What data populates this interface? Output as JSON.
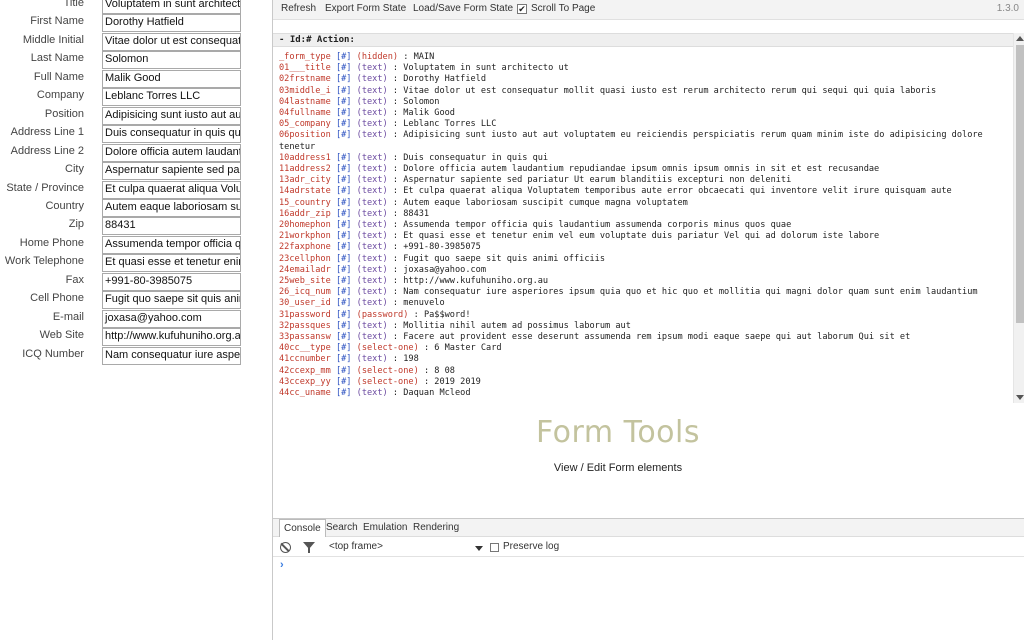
{
  "form": {
    "fields": [
      {
        "label": "Title",
        "value": "Voluptatem in sunt architecto ut"
      },
      {
        "label": "First Name",
        "value": "Dorothy Hatfield"
      },
      {
        "label": "Middle Initial",
        "value": "Vitae dolor ut est consequatur"
      },
      {
        "label": "Last Name",
        "value": "Solomon"
      },
      {
        "label": "Full Name",
        "value": "Malik Good"
      },
      {
        "label": "Company",
        "value": "Leblanc Torres LLC"
      },
      {
        "label": "Position",
        "value": "Adipisicing sunt iusto aut aut"
      },
      {
        "label": "Address Line 1",
        "value": "Duis consequatur in quis qui"
      },
      {
        "label": "Address Line 2",
        "value": "Dolore officia autem laudantium"
      },
      {
        "label": "City",
        "value": "Aspernatur sapiente sed pariatur"
      },
      {
        "label": "State / Province",
        "value": "Et culpa quaerat aliqua Voluptatem"
      },
      {
        "label": "Country",
        "value": "Autem eaque laboriosam suscipit"
      },
      {
        "label": "Zip",
        "value": "88431"
      },
      {
        "label": "Home Phone",
        "value": "Assumenda tempor officia quis"
      },
      {
        "label": "Work Telephone",
        "value": "Et quasi esse et tenetur enim"
      },
      {
        "label": "Fax",
        "value": "+991-80-3985075"
      },
      {
        "label": "Cell Phone",
        "value": "Fugit quo saepe sit quis animi"
      },
      {
        "label": "E-mail",
        "value": "joxasa@yahoo.com"
      },
      {
        "label": "Web Site",
        "value": "http://www.kufuhuniho.org.au"
      },
      {
        "label": "ICQ Number",
        "value": "Nam consequatur iure asperiores"
      }
    ]
  },
  "toolbar": {
    "refresh": "Refresh",
    "export": "Export Form State",
    "load_save": "Load/Save Form State",
    "scroll_to_page": "Scroll To Page",
    "scroll_checked": "✔",
    "version": "1.3.0"
  },
  "log": {
    "header": "-  Id:# Action:",
    "lines": [
      {
        "name": "_form_type",
        "hash": "[#]",
        "type": "(hidden)",
        "value": ": MAIN"
      },
      {
        "name": "01___title",
        "hash": "[#]",
        "type": "(text)",
        "value": ": Voluptatem in sunt architecto ut"
      },
      {
        "name": "02frstname",
        "hash": "[#]",
        "type": "(text)",
        "value": ": Dorothy Hatfield"
      },
      {
        "name": "03middle_i",
        "hash": "[#]",
        "type": "(text)",
        "value": ": Vitae dolor ut est consequatur mollit quasi iusto est rerum architecto rerum qui sequi qui quia laboris"
      },
      {
        "name": "04lastname",
        "hash": "[#]",
        "type": "(text)",
        "value": ": Solomon"
      },
      {
        "name": "04fullname",
        "hash": "[#]",
        "type": "(text)",
        "value": ": Malik Good"
      },
      {
        "name": "05_company",
        "hash": "[#]",
        "type": "(text)",
        "value": ": Leblanc Torres LLC"
      },
      {
        "name": "06position",
        "hash": "[#]",
        "type": "(text)",
        "value": ": Adipisicing sunt iusto aut aut voluptatem eu reiciendis perspiciatis rerum quam minim iste do adipisicing dolore tenetur"
      },
      {
        "name": "10address1",
        "hash": "[#]",
        "type": "(text)",
        "value": ": Duis consequatur in quis qui"
      },
      {
        "name": "11address2",
        "hash": "[#]",
        "type": "(text)",
        "value": ": Dolore officia autem laudantium repudiandae ipsum omnis ipsum omnis in sit et est recusandae"
      },
      {
        "name": "13adr_city",
        "hash": "[#]",
        "type": "(text)",
        "value": ": Aspernatur sapiente sed pariatur Ut earum blanditiis excepturi non deleniti"
      },
      {
        "name": "14adrstate",
        "hash": "[#]",
        "type": "(text)",
        "value": ": Et culpa quaerat aliqua Voluptatem temporibus aute error obcaecati qui inventore velit irure quisquam aute"
      },
      {
        "name": "15_country",
        "hash": "[#]",
        "type": "(text)",
        "value": ": Autem eaque laboriosam suscipit cumque magna voluptatem"
      },
      {
        "name": "16addr_zip",
        "hash": "[#]",
        "type": "(text)",
        "value": ": 88431"
      },
      {
        "name": "20homephon",
        "hash": "[#]",
        "type": "(text)",
        "value": ": Assumenda tempor officia quis laudantium assumenda corporis minus quos quae"
      },
      {
        "name": "21workphon",
        "hash": "[#]",
        "type": "(text)",
        "value": ": Et quasi esse et tenetur enim vel eum voluptate duis pariatur Vel qui ad dolorum iste labore"
      },
      {
        "name": "22faxphone",
        "hash": "[#]",
        "type": "(text)",
        "value": ": +991-80-3985075"
      },
      {
        "name": "23cellphon",
        "hash": "[#]",
        "type": "(text)",
        "value": ": Fugit quo saepe sit quis animi officiis"
      },
      {
        "name": "24emailadr",
        "hash": "[#]",
        "type": "(text)",
        "value": ": joxasa@yahoo.com"
      },
      {
        "name": "25web_site",
        "hash": "[#]",
        "type": "(text)",
        "value": ": http://www.kufuhuniho.org.au"
      },
      {
        "name": "26_icq_num",
        "hash": "[#]",
        "type": "(text)",
        "value": ": Nam consequatur iure asperiores ipsum quia quo et hic quo et mollitia qui magni dolor quam sunt enim laudantium"
      },
      {
        "name": "30_user_id",
        "hash": "[#]",
        "type": "(text)",
        "value": ": menuvelo"
      },
      {
        "name": "31password",
        "hash": "[#]",
        "type": "(password)",
        "value": ": Pa$$word!"
      },
      {
        "name": "32passques",
        "hash": "[#]",
        "type": "(text)",
        "value": ": Mollitia nihil autem ad possimus laborum aut"
      },
      {
        "name": "33passansw",
        "hash": "[#]",
        "type": "(text)",
        "value": ": Facere aut provident esse deserunt assumenda rem ipsum modi eaque saepe qui aut laborum Qui sit et"
      },
      {
        "name": "40cc__type",
        "hash": "[#]",
        "type": "(select-one)",
        "value": ": 6 Master Card"
      },
      {
        "name": "41ccnumber",
        "hash": "[#]",
        "type": "(text)",
        "value": ": 198"
      },
      {
        "name": "42ccexp_mm",
        "hash": "[#]",
        "type": "(select-one)",
        "value": ": 8 08"
      },
      {
        "name": "43ccexp_yy",
        "hash": "[#]",
        "type": "(select-one)",
        "value": ": 2019 2019"
      },
      {
        "name": "44cc_uname",
        "hash": "[#]",
        "type": "(text)",
        "value": ": Daquan Mcleod"
      }
    ]
  },
  "brand": {
    "title": "Form Tools",
    "subtitle": "View / Edit Form elements"
  },
  "console": {
    "tabs": [
      "Console",
      "Search",
      "Emulation",
      "Rendering"
    ],
    "frame": "<top frame>",
    "preserve_log": "Preserve log",
    "prompt": "›"
  }
}
